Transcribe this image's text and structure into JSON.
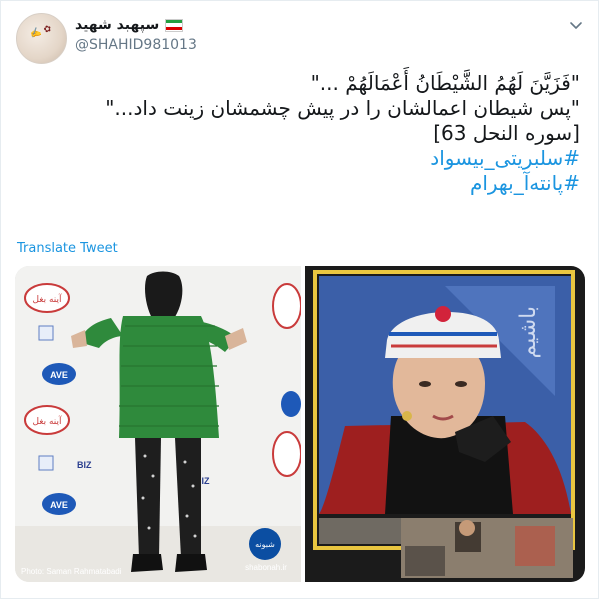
{
  "tweet": {
    "display_name": "سپهبد شهید",
    "handle": "@SHAHID981013",
    "text_lines": [
      "\"فَزَيَّنَ لَهُمُ الشَّيْطَانُ أَعْمَالَهُمْ ...\"",
      "\"پس شیطان اعمالشان را در پیش چشمشان زینت داد...\"",
      "[سوره النحل 63]"
    ],
    "hashtags": [
      "#سلبریتی_بیسواد",
      "#پانته‌آ_بهرام"
    ],
    "translate_label": "Translate Tweet"
  },
  "icons": {
    "avatar": "avatar-image",
    "flag": "iran-flag-icon",
    "menu": "chevron-down-icon"
  },
  "media": {
    "left_image": {
      "subject": "woman-in-green-coat",
      "credit": "Photo: Saman Rahmatabadi",
      "watermark_top": "شبونه",
      "watermark_bottom": "shabonah.ir",
      "sponsor_logo": "AVE",
      "brand_text": "آینه بغل",
      "biz_text": "BIZ"
    },
    "right_image": {
      "subject": "woman-with-embroidered-hat",
      "side_text": "باشیم"
    }
  },
  "colors": {
    "link": "#1b95e0",
    "text": "#14171a",
    "secondary": "#657786",
    "green_coat": "#2f8a3c",
    "frame_gold": "#e9c640"
  }
}
